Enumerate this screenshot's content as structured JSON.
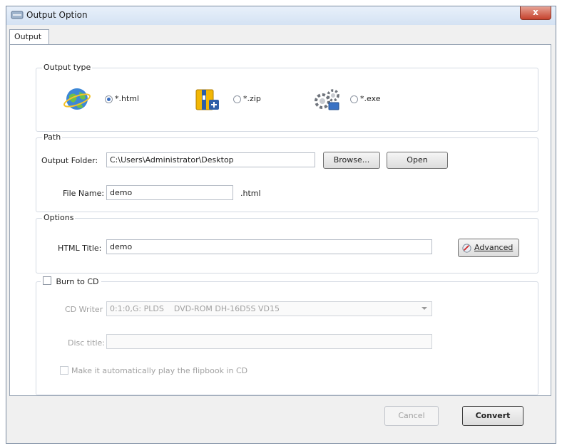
{
  "window": {
    "title": "Output Option",
    "close_label": "x"
  },
  "tabs": [
    {
      "label": "Output"
    }
  ],
  "output_type": {
    "group_title": "Output type",
    "options": [
      {
        "label": "*.html",
        "icon": "globe-icon",
        "selected": true
      },
      {
        "label": "*.zip",
        "icon": "zip-archive-icon",
        "selected": false
      },
      {
        "label": "*.exe",
        "icon": "gears-icon",
        "selected": false
      }
    ]
  },
  "path": {
    "group_title": "Path",
    "output_folder_label": "Output Folder:",
    "output_folder_value": "C:\\Users\\Administrator\\Desktop",
    "browse_label": "Browse...",
    "open_label": "Open",
    "file_name_label": "File Name:",
    "file_name_value": "demo",
    "extension": ".html"
  },
  "options": {
    "group_title": "Options",
    "html_title_label": "HTML Title:",
    "html_title_value": "demo",
    "advanced_label": "Advanced"
  },
  "burn": {
    "checkbox_label": "Burn to CD",
    "checked": false,
    "cd_writer_label": "CD Writer",
    "cd_writer_value": "0:1:0,G: PLDS    DVD-ROM DH-16D5S VD15",
    "disc_title_label": "Disc title:",
    "disc_title_value": "",
    "autoplay_label": "Make it automatically play the flipbook in CD"
  },
  "footer": {
    "cancel_label": "Cancel",
    "convert_label": "Convert"
  }
}
